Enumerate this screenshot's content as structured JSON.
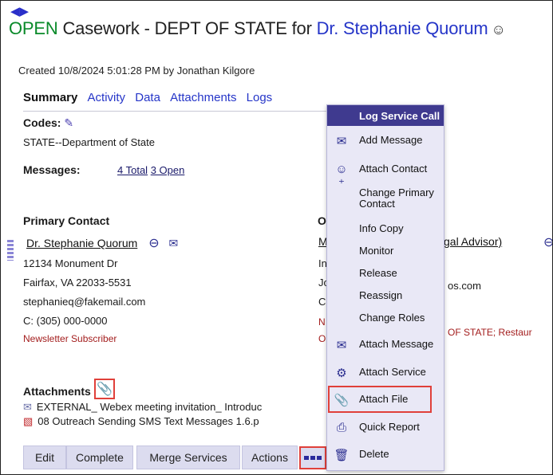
{
  "header": {
    "status": "OPEN",
    "title_mid": " Casework - DEPT OF STATE for ",
    "client_name": "Dr. Stephanie Quorum",
    "created": "Created 10/8/2024 5:01:28 PM by Jonathan Kilgore"
  },
  "tabs": [
    "Summary",
    "Activity",
    "Data",
    "Attachments",
    "Logs"
  ],
  "codes": {
    "label": "Codes:",
    "value": "STATE--Department of State"
  },
  "messages": {
    "label": "Messages:",
    "total": "4 Total",
    "open": "3 Open"
  },
  "primary_contact": {
    "heading": "Primary Contact",
    "name": "Dr. Stephanie Quorum",
    "address1": "12134 Monument Dr",
    "address2": "Fairfax, VA 22033-5531",
    "email": "stephanieq@fakemail.com",
    "phone": "C: (305) 000-0000",
    "tag": "Newsletter Subscriber"
  },
  "other_contact": {
    "heading_partial": "O",
    "name_partial": "M",
    "role_partial": "gal Advisor)",
    "line1_partial": "In",
    "line2_partial": "Jo",
    "email_partial": "os.com",
    "line3_partial": "C:",
    "tag_partial_a": "N",
    "tag_partial_b": "O",
    "tag_right": "OF STATE; Restaur"
  },
  "attachments": {
    "heading": "Attachments",
    "items": [
      "EXTERNAL_ Webex meeting invitation_ Introduc",
      "08 Outreach Sending SMS Text Messages 1.6.p"
    ]
  },
  "buttons": {
    "edit": "Edit",
    "complete": "Complete",
    "merge": "Merge Services",
    "actions": "Actions"
  },
  "menu": {
    "header": "Log Service Call",
    "items": [
      {
        "label": "Add Message",
        "icon": "envelope-icon"
      },
      {
        "label": "Attach Contact",
        "icon": "add-person-icon"
      },
      {
        "label": "Change Primary Contact",
        "icon": ""
      },
      {
        "label": "Info Copy",
        "icon": ""
      },
      {
        "label": "Monitor",
        "icon": ""
      },
      {
        "label": "Release",
        "icon": ""
      },
      {
        "label": "Reassign",
        "icon": ""
      },
      {
        "label": "Change Roles",
        "icon": ""
      },
      {
        "label": "Attach Message",
        "icon": "attach-message-icon"
      },
      {
        "label": "Attach Service",
        "icon": "attach-service-icon"
      },
      {
        "label": "Attach File",
        "icon": "paperclip-icon"
      },
      {
        "label": "Quick Report",
        "icon": "printer-icon"
      },
      {
        "label": "Delete",
        "icon": "trash-icon"
      }
    ]
  },
  "colors": {
    "accent": "#2535c8",
    "open": "#0a8a2a",
    "menu_header": "#3f3a8f",
    "highlight": "#e0403a"
  }
}
